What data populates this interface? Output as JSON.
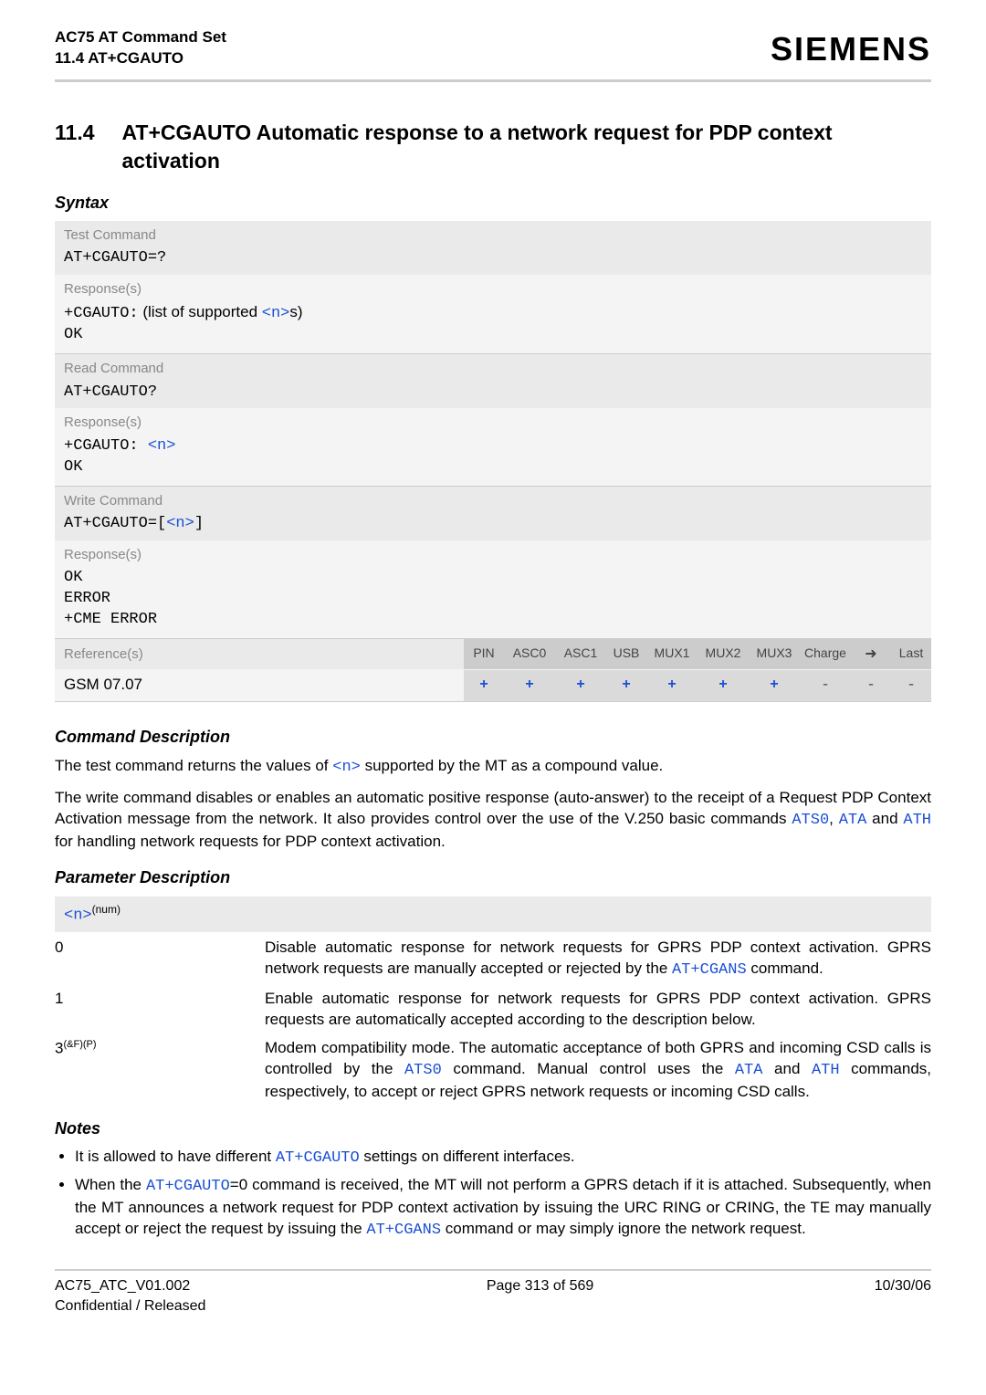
{
  "header": {
    "title": "AC75 AT Command Set",
    "subtitle": "11.4 AT+CGAUTO",
    "logo": "SIEMENS"
  },
  "section": {
    "number": "11.4",
    "title": "AT+CGAUTO   Automatic response to a network request for PDP context activation"
  },
  "labels": {
    "syntax": "Syntax",
    "test_command": "Test Command",
    "read_command": "Read Command",
    "write_command": "Write Command",
    "responses": "Response(s)",
    "references": "Reference(s)",
    "cmd_desc": "Command Description",
    "param_desc": "Parameter Description",
    "notes": "Notes"
  },
  "syntax": {
    "test_cmd": "AT+CGAUTO=?",
    "test_resp_prefix": "+CGAUTO:",
    "test_resp_mid": " (list of supported ",
    "test_resp_param": "<n>",
    "test_resp_suffix": "s)",
    "ok": "OK",
    "read_cmd": "AT+CGAUTO?",
    "read_resp_prefix": "+CGAUTO: ",
    "read_resp_param": "<n>",
    "write_cmd_prefix": "AT+CGAUTO=[",
    "write_cmd_param": "<n>",
    "write_cmd_suffix": "]",
    "write_resp_ok": "OK",
    "write_resp_error": "ERROR",
    "write_resp_cme": "+CME ERROR"
  },
  "ref": {
    "cols": [
      "PIN",
      "ASC0",
      "ASC1",
      "USB",
      "MUX1",
      "MUX2",
      "MUX3",
      "Charge",
      "➜",
      "Last"
    ],
    "name": "GSM 07.07",
    "vals": [
      "+",
      "+",
      "+",
      "+",
      "+",
      "+",
      "+",
      "-",
      "-",
      "-"
    ]
  },
  "cmd_desc": {
    "p1a": "The test command returns the values of ",
    "p1b": "<n>",
    "p1c": " supported by the MT as a compound value.",
    "p2a": "The write command disables or enables an automatic positive response (auto-answer) to the receipt of a Request PDP Context Activation message from the network. It also provides control over the use of the V.250 basic commands ",
    "ats0": "ATS0",
    "comma1": ", ",
    "ata": "ATA",
    "and": " and ",
    "ath": "ATH",
    "p2b": " for handling network requests for PDP context activation."
  },
  "param": {
    "n_label": "<n>",
    "n_sup": "(num)",
    "rows": [
      {
        "key": "0",
        "desc_a": "Disable automatic response for network requests for GPRS PDP context activation. GPRS network requests are manually accepted or rejected by the ",
        "desc_link": "AT+CGANS",
        "desc_b": " command."
      },
      {
        "key": "1",
        "desc_a": "Enable automatic response for network requests for GPRS PDP context activation. GPRS requests are automatically accepted according to the description below.",
        "desc_link": "",
        "desc_b": ""
      },
      {
        "key": "3",
        "key_sup": "(&F)(P)",
        "desc_a": "Modem compatibility mode. The automatic acceptance of both GPRS and incoming CSD calls is controlled by the ",
        "desc_link": "ATS0",
        "desc_b": " command. Manual control uses the ",
        "desc_link2": "ATA",
        "desc_c": " and ",
        "desc_link3": "ATH",
        "desc_d": " commands, respectively, to accept or reject GPRS network requests or incoming CSD calls."
      }
    ]
  },
  "notes": {
    "n1a": "It is allowed to have different ",
    "n1link": "AT+CGAUTO",
    "n1b": " settings on different interfaces.",
    "n2a": "When the ",
    "n2link1": "AT+CGAUTO",
    "n2b": "=0 command is received, the MT will not perform a GPRS detach if it is attached. Subsequently, when the MT announces a network request for PDP context activation by issuing the URC RING or CRING, the TE may manually accept or reject the request by issuing the ",
    "n2link2": "AT+CGANS",
    "n2c": " command or may simply ignore the network request."
  },
  "footer": {
    "left": "AC75_ATC_V01.002",
    "left2": "Confidential / Released",
    "center": "Page 313 of 569",
    "right": "10/30/06"
  }
}
